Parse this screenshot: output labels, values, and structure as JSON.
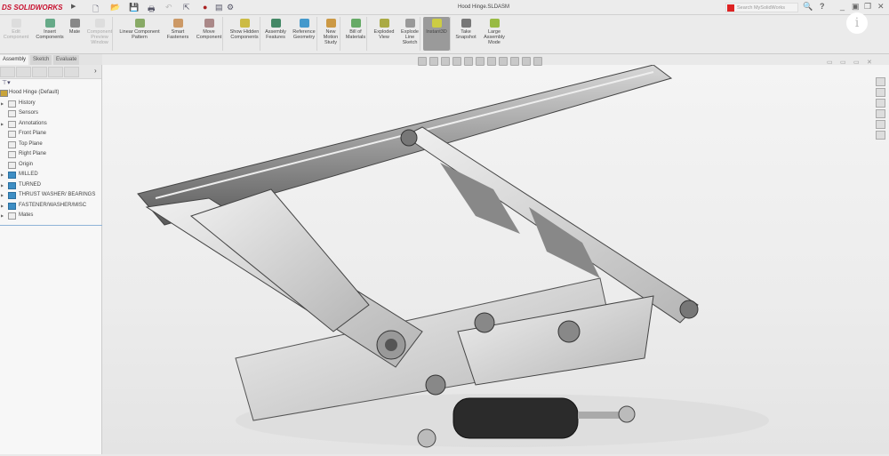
{
  "app": {
    "logo": "SOLIDWORKS",
    "document_title": "Hood Hinge.SLDASM",
    "search_placeholder": "Search MySolidWorks",
    "help": "?"
  },
  "quick_access": [
    "new-icon",
    "open-icon",
    "save-icon",
    "print-icon",
    "undo-icon",
    "select-icon",
    "rebuild-icon",
    "file-properties-icon",
    "options-icon"
  ],
  "ribbon": {
    "buttons": [
      {
        "label": "Edit Component",
        "disabled": true
      },
      {
        "label": "Insert Components"
      },
      {
        "label": "Mate"
      },
      {
        "label": "Component Preview Window",
        "disabled": true
      },
      {
        "label": "Linear Component Pattern"
      },
      {
        "label": "Smart Fasteners"
      },
      {
        "label": "Move Component"
      },
      {
        "label": "Show Hidden Components"
      },
      {
        "label": "Assembly Features"
      },
      {
        "label": "Reference Geometry"
      },
      {
        "label": "New Motion Study"
      },
      {
        "label": "Bill of Materials"
      },
      {
        "label": "Exploded View"
      },
      {
        "label": "Explode Line Sketch"
      },
      {
        "label": "Instant3D",
        "active": true
      },
      {
        "label": "Take Snapshot"
      },
      {
        "label": "Large Assembly Mode"
      }
    ]
  },
  "tabs": [
    {
      "label": "Assembly",
      "selected": true
    },
    {
      "label": "Sketch"
    },
    {
      "label": "Evaluate"
    }
  ],
  "tree": {
    "root": "Hood Hinge  (Default)",
    "items": [
      {
        "label": "History",
        "expandable": true
      },
      {
        "label": "Sensors"
      },
      {
        "label": "Annotations",
        "expandable": true
      },
      {
        "label": "Front Plane"
      },
      {
        "label": "Top Plane"
      },
      {
        "label": "Right Plane"
      },
      {
        "label": "Origin"
      },
      {
        "label": "MILLED",
        "folder": true,
        "expandable": true
      },
      {
        "label": "TURNED",
        "folder": true,
        "expandable": true
      },
      {
        "label": "THRUST WASHER/ BEARINGS",
        "folder": true,
        "expandable": true
      },
      {
        "label": "FASTENER/WASHER/MISC",
        "folder": true,
        "expandable": true
      },
      {
        "label": "Mates",
        "expandable": true
      }
    ]
  },
  "colors": {
    "brand": "#c8102e",
    "folder": "#3e8ec4",
    "active_button": "#9a9a9a"
  }
}
